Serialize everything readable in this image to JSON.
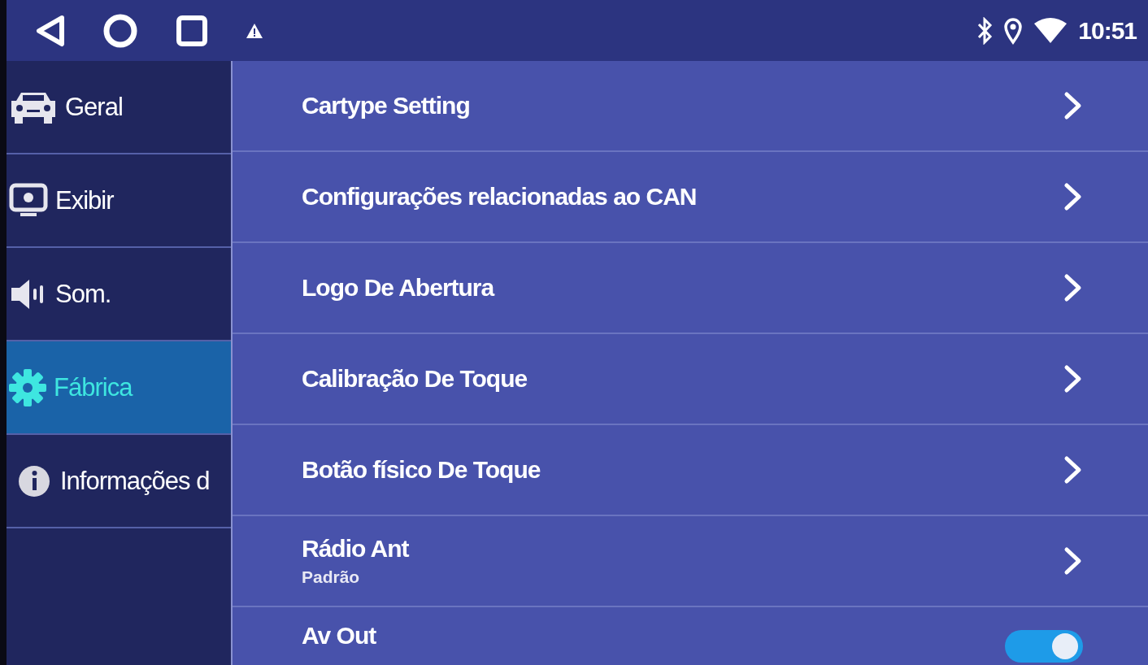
{
  "status_bar": {
    "time": "10:51",
    "notification_warning": true
  },
  "sidebar": {
    "items": [
      {
        "kind": "car",
        "label": "Geral",
        "selected": false
      },
      {
        "kind": "display",
        "label": "Exibir",
        "selected": false
      },
      {
        "kind": "sound",
        "label": "Som.",
        "selected": false
      },
      {
        "kind": "gear",
        "label": "Fábrica",
        "selected": true
      },
      {
        "kind": "info",
        "label": "Informações d",
        "selected": false
      }
    ]
  },
  "settings": [
    {
      "kind": "link",
      "title": "Cartype Setting"
    },
    {
      "kind": "link",
      "title": "Configurações relacionadas ao CAN"
    },
    {
      "kind": "link",
      "title": "Logo De Abertura"
    },
    {
      "kind": "link",
      "title": "Calibração De Toque"
    },
    {
      "kind": "link",
      "title": "Botão físico De Toque"
    },
    {
      "kind": "link",
      "title": "Rádio Ant",
      "subtitle": "Padrão"
    },
    {
      "kind": "toggle",
      "title": "Av Out",
      "on": true
    }
  ]
}
